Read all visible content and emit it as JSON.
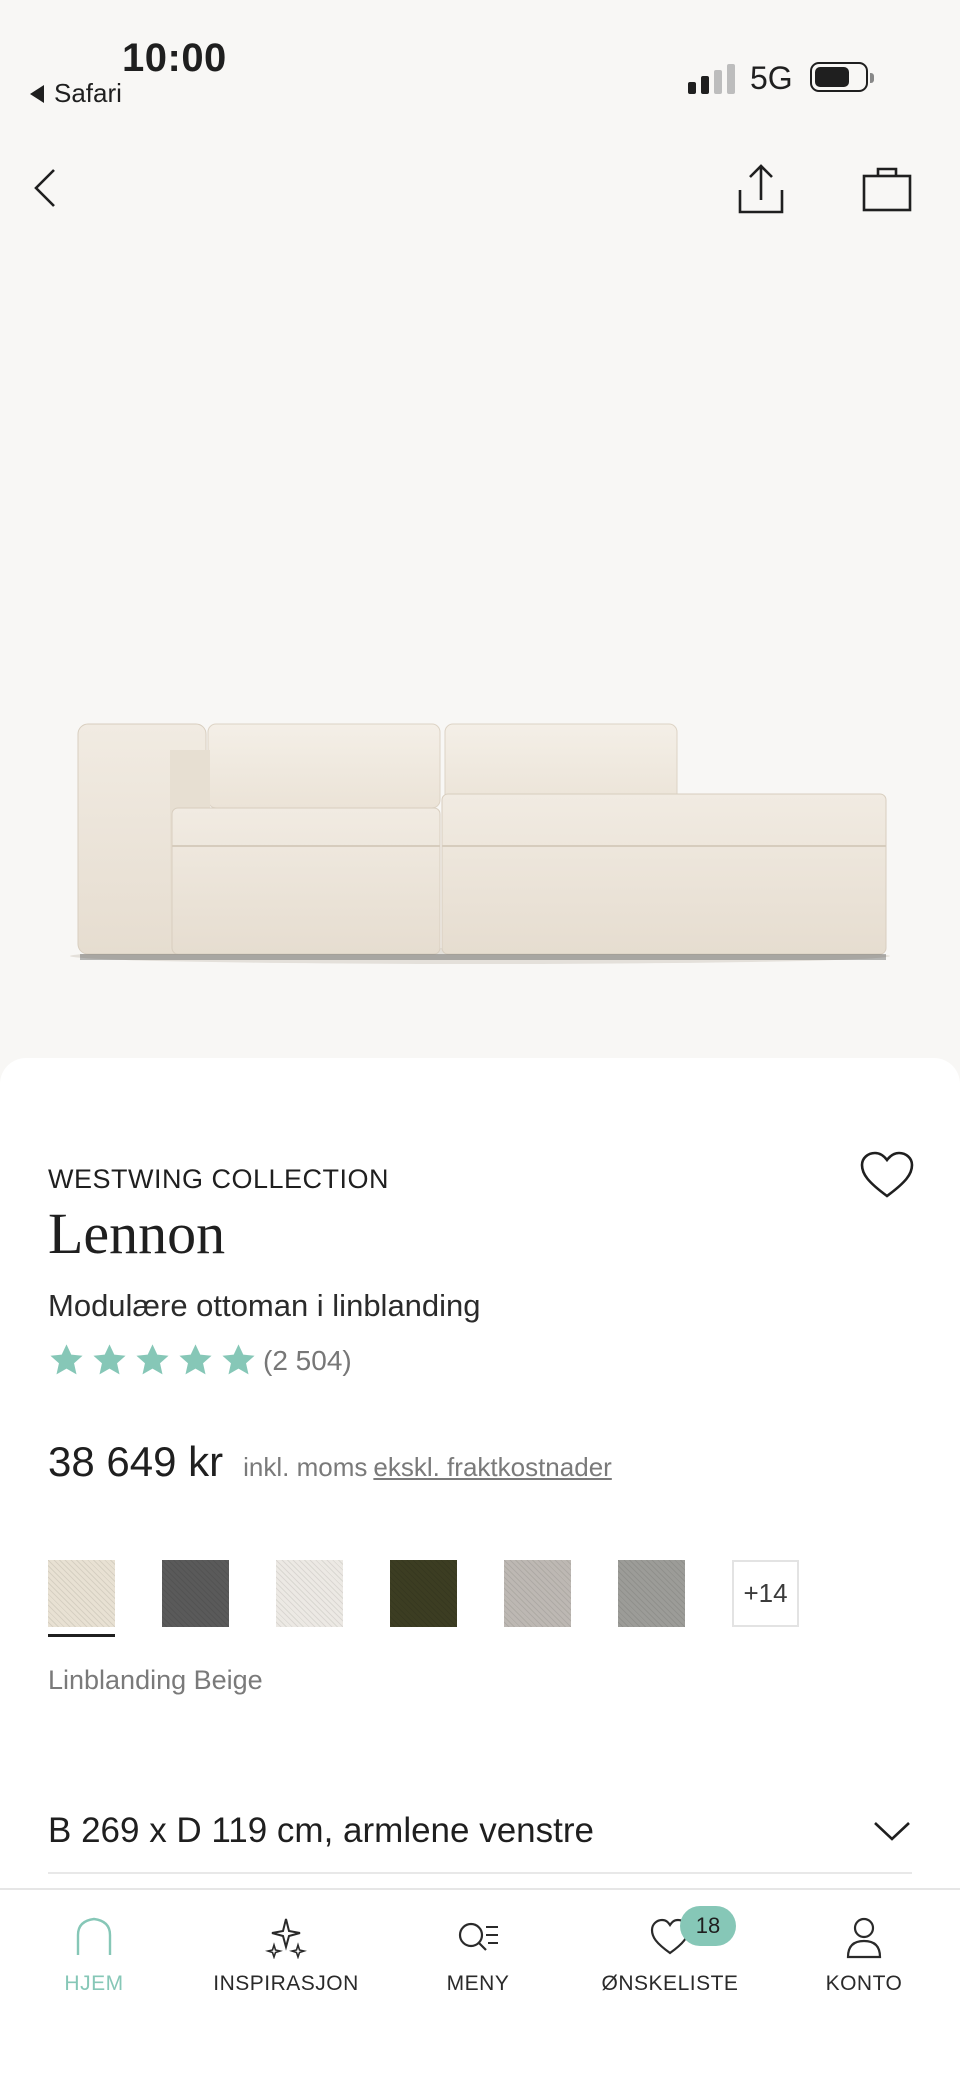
{
  "status_bar": {
    "time": "10:00",
    "back_app": "Safari",
    "network": "5G"
  },
  "icons": {
    "back": "chevron-left-icon",
    "share": "share-icon",
    "bag": "shopping-bag-icon",
    "wishlist": "heart-icon"
  },
  "product": {
    "brand": "WESTWING COLLECTION",
    "name": "Lennon",
    "subtitle": "Modulære ottoman i linblanding",
    "rating_stars": 5,
    "rating_count": "(2 504)",
    "price": "38 649 kr",
    "vat_note": "inkl. moms",
    "shipping_link": "ekskl. fraktkostnader",
    "selected_color": "Linblanding Beige",
    "more_swatches": "+14",
    "dimension": "B 269 x D 119 cm, armlene venstre"
  },
  "colors": {
    "accent": "#86c7b7",
    "swatches": [
      "#e8e1d3",
      "#5a5a5a",
      "#ece9e4",
      "#3c3d22",
      "#bdb8b3",
      "#9c9c98"
    ]
  },
  "tabbar": {
    "items": [
      {
        "label": "HJEM",
        "icon": "home-icon",
        "active": true
      },
      {
        "label": "INSPIRASJON",
        "icon": "sparkle-icon",
        "active": false
      },
      {
        "label": "MENY",
        "icon": "search-menu-icon",
        "active": false
      },
      {
        "label": "ØNSKELISTE",
        "icon": "heart-icon",
        "active": false,
        "badge": "18"
      },
      {
        "label": "KONTO",
        "icon": "user-icon",
        "active": false
      }
    ]
  }
}
